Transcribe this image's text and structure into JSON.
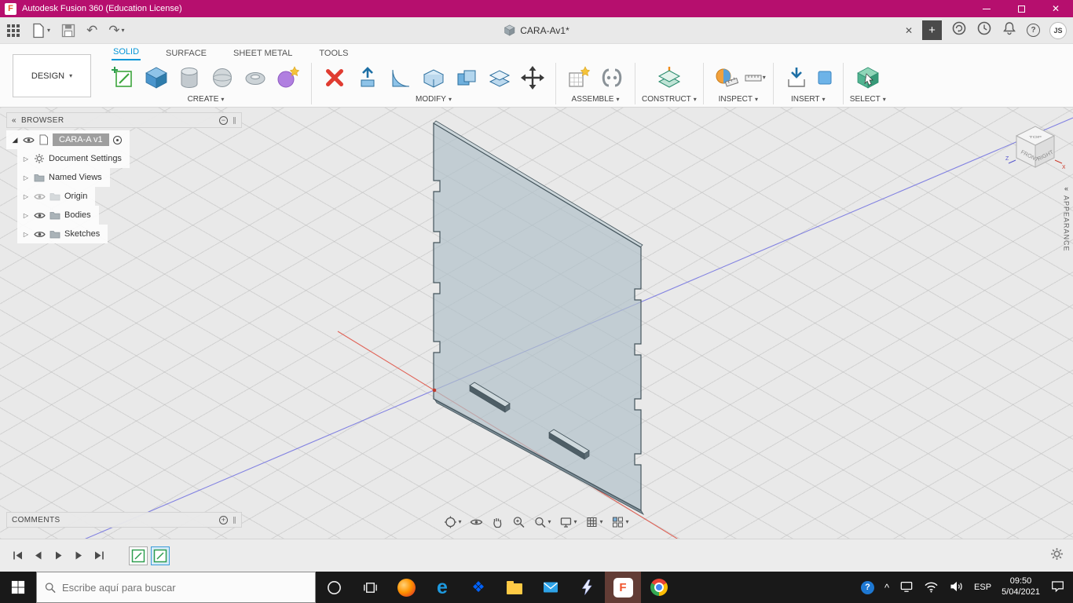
{
  "window": {
    "title": "Autodesk Fusion 360 (Education License)"
  },
  "qat": {
    "doc_tab": "CARA-Av1*"
  },
  "account": {
    "initials": "JS"
  },
  "ribbon": {
    "design_menu": "DESIGN",
    "tabs": [
      {
        "label": "SOLID"
      },
      {
        "label": "SURFACE"
      },
      {
        "label": "SHEET METAL"
      },
      {
        "label": "TOOLS"
      }
    ],
    "groups": [
      {
        "label": "CREATE"
      },
      {
        "label": "MODIFY"
      },
      {
        "label": "ASSEMBLE"
      },
      {
        "label": "CONSTRUCT"
      },
      {
        "label": "INSPECT"
      },
      {
        "label": "INSERT"
      },
      {
        "label": "SELECT"
      }
    ]
  },
  "browser": {
    "title": "BROWSER",
    "root": {
      "label": "CARA-A v1"
    },
    "items": [
      {
        "label": "Document Settings"
      },
      {
        "label": "Named Views"
      },
      {
        "label": "Origin"
      },
      {
        "label": "Bodies"
      },
      {
        "label": "Sketches"
      }
    ]
  },
  "comments": {
    "title": "COMMENTS"
  },
  "viewcube": {
    "top": "TOP",
    "front": "FRONT",
    "right": "RIGHT",
    "axis_x": "X",
    "axis_z": "Z"
  },
  "panels": {
    "appearance": "APPEARANCE"
  },
  "taskbar": {
    "search_placeholder": "Escribe aquí para buscar",
    "language": "ESP",
    "clock": {
      "time": "09:50",
      "date": "5/04/2021"
    }
  },
  "icons": {
    "fusion_logo_letter": "F",
    "caret_down": "▾",
    "close": "✕",
    "plus": "+",
    "minus": "−",
    "grip": "∥",
    "chevrons_left": "«",
    "tree_expanded": "◢",
    "tree_collapsed": "▷",
    "question": "?",
    "undo": "↶",
    "redo": "↷",
    "chevron_up": "^",
    "edge_letter": "e",
    "dropbox_glyph": "❖"
  }
}
